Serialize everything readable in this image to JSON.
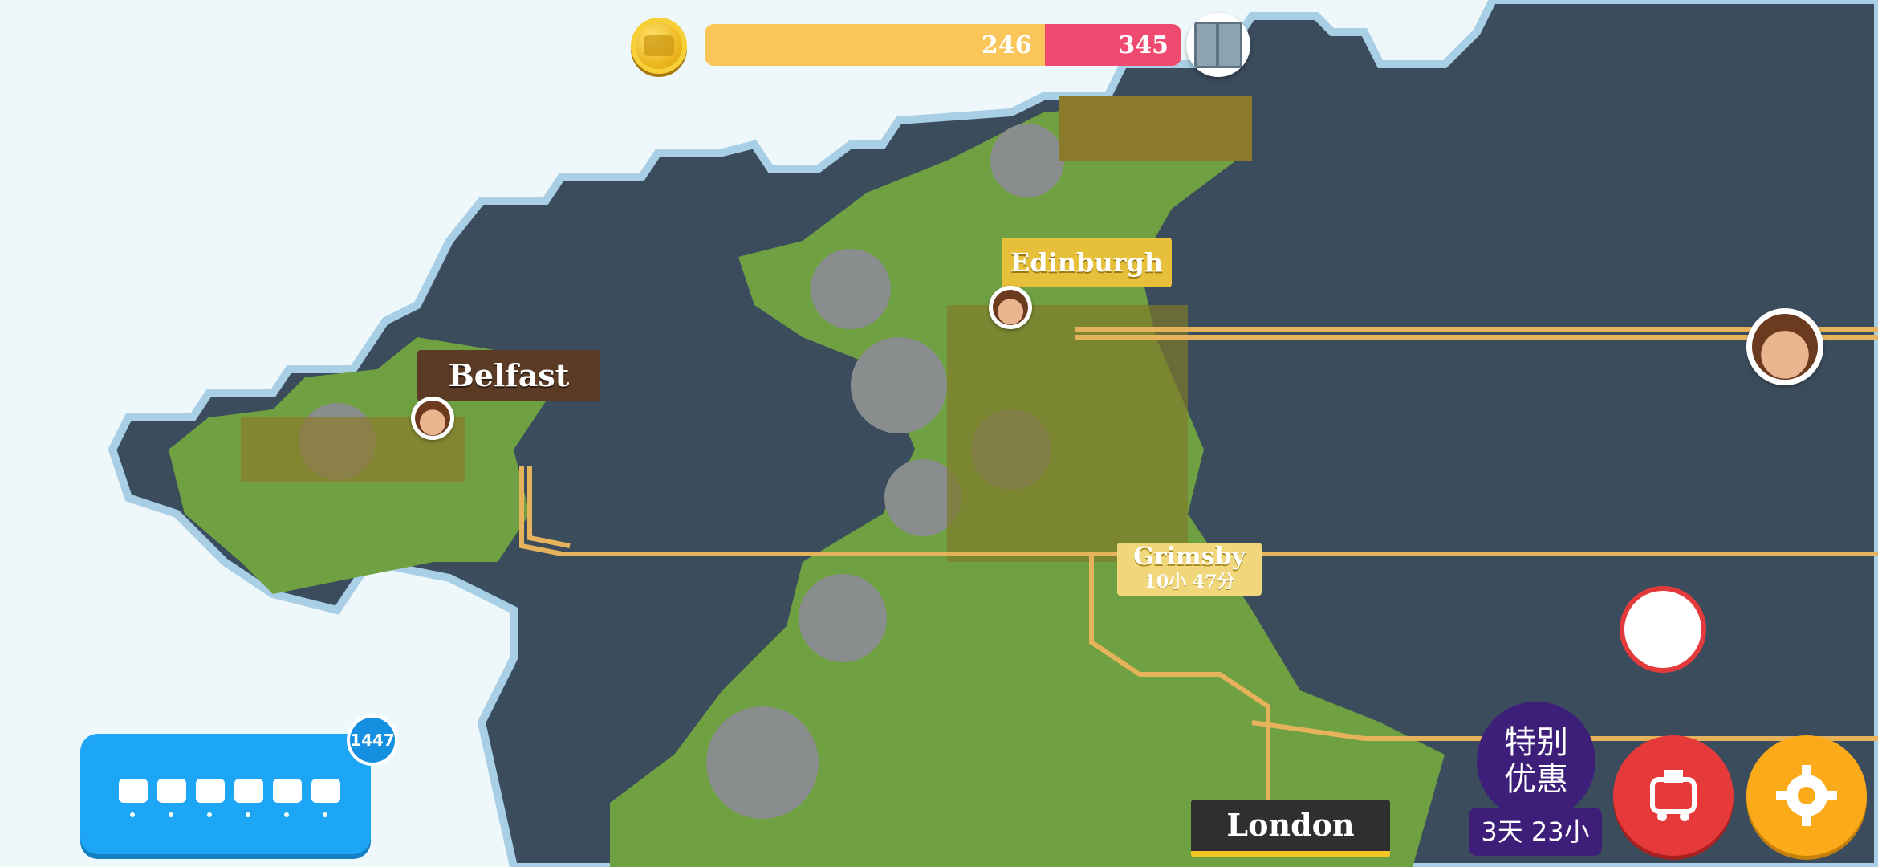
{
  "progress": {
    "current": "246",
    "target": "345",
    "fill_fraction": 0.713
  },
  "icons": {
    "coin": "train-coin-icon",
    "crate": "crate-icon",
    "train": "locomotive-icon",
    "settings": "gear-icon",
    "marker": "horn-marker-icon"
  },
  "cities": {
    "belfast": "Belfast",
    "edinburgh": "Edinburgh",
    "grimsby": "Grimsby",
    "grimsby_timer": "10小 47分",
    "london": "London"
  },
  "trains_panel": {
    "count_badge": "1447"
  },
  "offer": {
    "line1": "特别",
    "line2": "优惠",
    "timer": "3天 23小"
  },
  "colors": {
    "sea": "#3b4c5d",
    "land": "#7fa94a",
    "rail": "#e6b35c",
    "accent_red": "#e63a3a",
    "accent_orange": "#fbab1a",
    "accent_blue": "#1ea6f6"
  }
}
